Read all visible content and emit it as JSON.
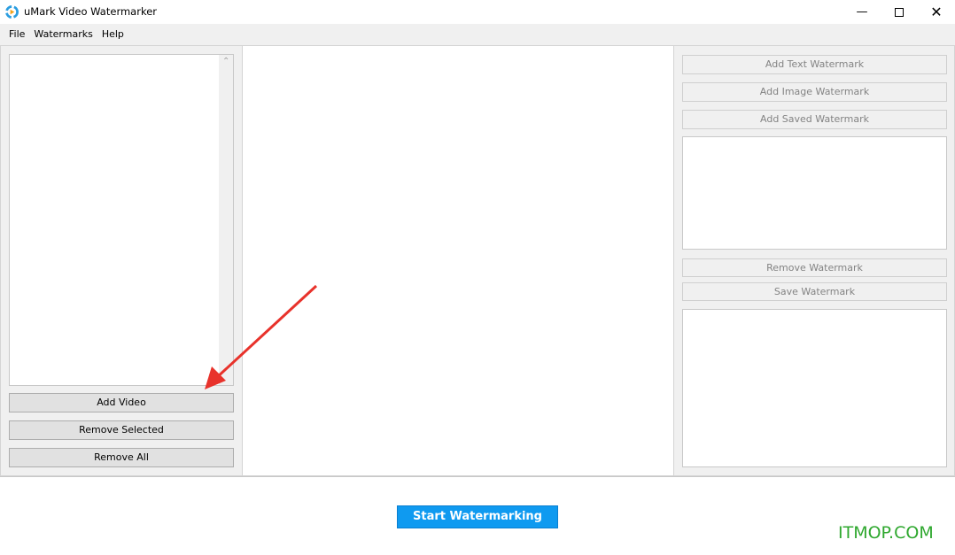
{
  "app": {
    "title": "uMark Video Watermarker"
  },
  "menu": [
    "File",
    "Watermarks",
    "Help"
  ],
  "left": {
    "add_video": "Add Video",
    "remove_selected": "Remove Selected",
    "remove_all": "Remove All"
  },
  "right": {
    "add_text": "Add Text Watermark",
    "add_image": "Add Image Watermark",
    "add_saved": "Add Saved Watermark",
    "remove": "Remove Watermark",
    "save": "Save Watermark"
  },
  "footer": {
    "start": "Start Watermarking"
  },
  "watermark_text": "ITMOP.COM",
  "colors": {
    "accent": "#0f9af0",
    "arrow": "#e8322b",
    "watermark": "#2fa82f"
  }
}
